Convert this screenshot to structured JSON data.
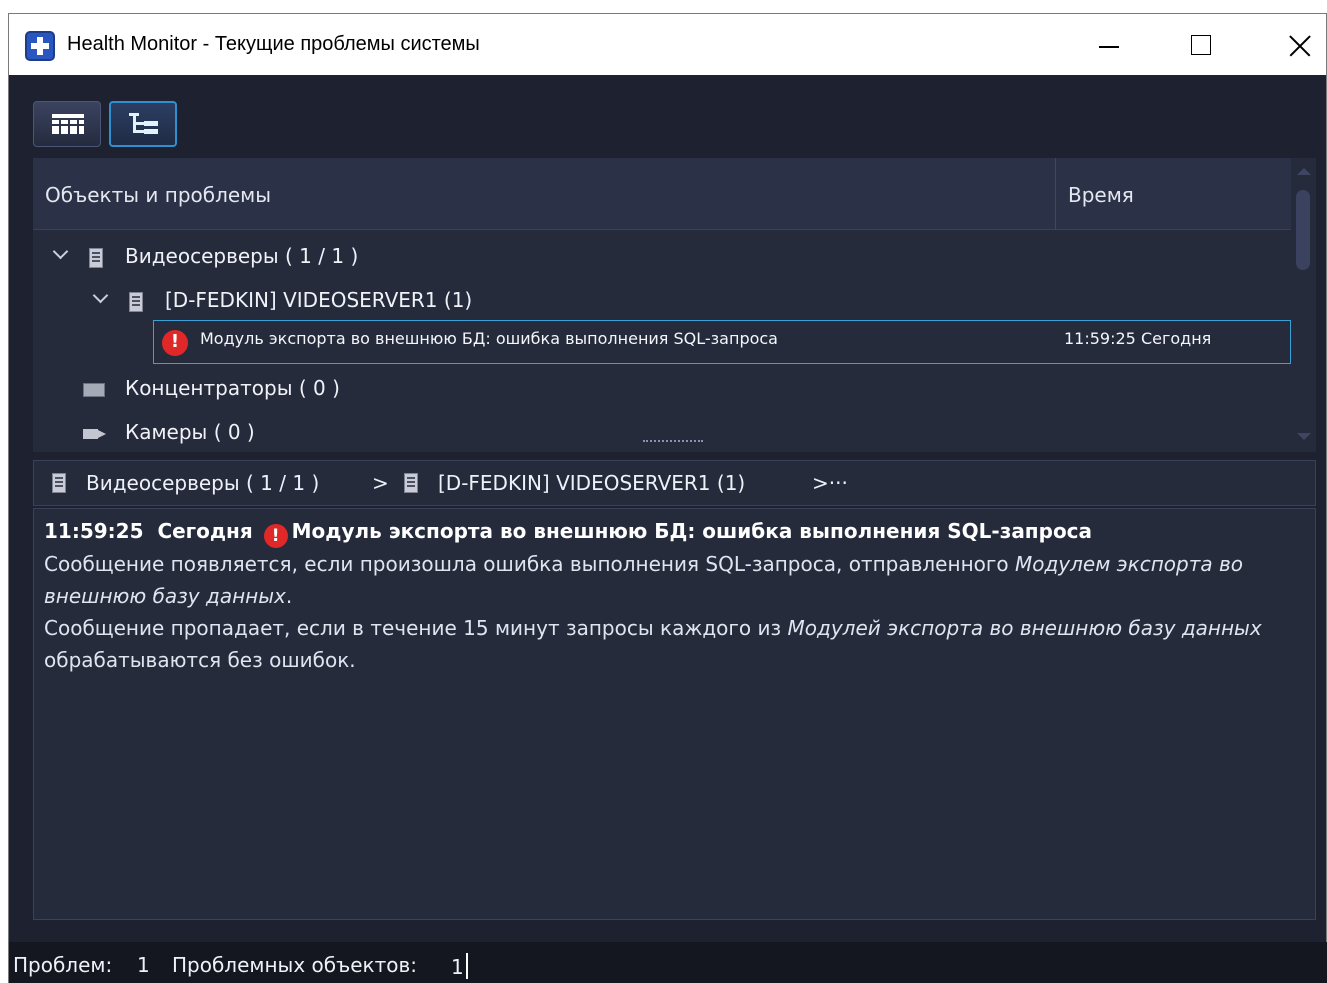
{
  "window": {
    "title": "Health Monitor - Текущие проблемы системы"
  },
  "toolbar": {
    "table_view_icon": "table-grid-icon",
    "tree_view_icon": "tree-view-icon"
  },
  "tree": {
    "columns": [
      "Объекты и проблемы",
      "Время"
    ],
    "rows": [
      {
        "label": "Видеосерверы ( 1 / 1 )",
        "icon": "server-icon",
        "expanded": true
      },
      {
        "label": "[D-FEDKIN] VIDEOSERVER1 (1)",
        "icon": "server-icon",
        "expanded": true
      },
      {
        "label": "Модуль экспорта во внешнюю БД: ошибка выполнения SQL-запроса",
        "icon": "error-icon",
        "time": "11:59:25  Сегодня",
        "selected": true
      },
      {
        "label": "Концентраторы ( 0 )",
        "icon": "hub-icon"
      },
      {
        "label": "Камеры ( 0 )",
        "icon": "camera-icon"
      }
    ]
  },
  "breadcrumb": {
    "part1": "Видеосерверы ( 1 / 1 )",
    "sep1": ">",
    "part2": "[D-FEDKIN] VIDEOSERVER1 (1)",
    "tail": ">···"
  },
  "details": {
    "time": "11:59:25",
    "day": "Сегодня",
    "title": "Модуль экспорта во внешнюю БД: ошибка выполнения SQL-запроса",
    "p1_text": "Сообщение появляется, если произошла ошибка выполнения SQL-запроса, отправленного ",
    "p1_em": "Модулем экспорта во внешнюю базу данных",
    "p1_end": ".",
    "p2_text": "Сообщение пропадает, если в течение 15 минут запросы каждого из ",
    "p2_em": "Модулей экспорта во внешнюю базу данных",
    "p2_end": " обрабатываются без ошибок."
  },
  "status": {
    "problems_label": "Проблем:",
    "problems_count": "1",
    "objects_label": "Проблемных объектов:",
    "objects_count": "1"
  },
  "colors": {
    "background": "#1e2230",
    "panel": "#262b3c",
    "selection_border": "#3aa0d8",
    "error": "#e02828"
  }
}
